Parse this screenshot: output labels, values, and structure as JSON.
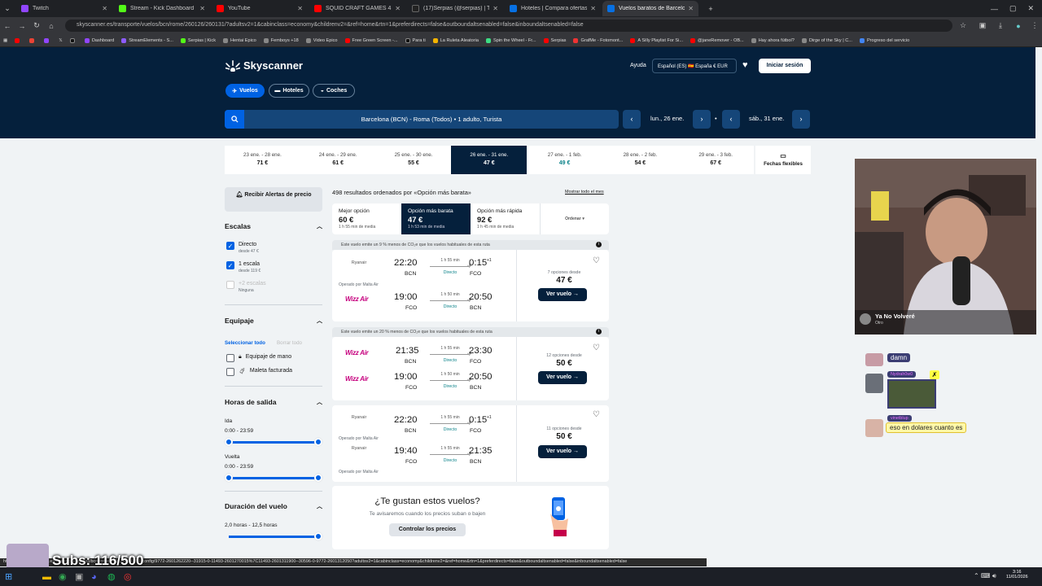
{
  "browser": {
    "tabs": [
      {
        "label": "Twitch",
        "color": "#9146ff"
      },
      {
        "label": "Stream - Kick Dashboard",
        "color": "#53fc18"
      },
      {
        "label": "YouTube",
        "color": "#ff0000"
      },
      {
        "label": "SQUID CRAFT GAMES 4: POV D",
        "color": "#ff0000"
      },
      {
        "label": "(17)Serpias (@serpias) | TikTok",
        "color": "#222222"
      },
      {
        "label": "Hoteles | Compara ofertas de h",
        "color": "#0770e3"
      },
      {
        "label": "Vuelos baratos de Barcelona a",
        "color": "#0770e3"
      }
    ],
    "url": "skyscanner.es/transporte/vuelos/bcn/rome/260126/260131/?adultsv2=1&cabinclass=economy&childrenv2=&ref=home&rtn=1&preferdirects=false&outboundaltsenabled=false&inboundaltsenabled=false",
    "bookmarks": [
      "Dashboard",
      "StreamElements - S...",
      "Serpias | Kick",
      "Hentai Epico",
      "Femboys +18",
      "Video Epico",
      "Free Green Screen -...",
      "Para ti",
      "La Ruleta Aleatoria",
      "Spin the Wheel - Fr...",
      "Serpias",
      "GrafMe - Fotomont...",
      "A Silly Playlist For Si...",
      "@janeRemover - OB...",
      "Hay ahora fútbol?",
      "Dirge of the Sky | C...",
      "Progreso del servicio"
    ],
    "status_url": "https://www.skyscanner.es/transporte/vuelos/bcn/rome/260126/260131/config/9772-2601262220--31915-0-11493-2601270015%7C11493-2601311900--30596-0-9772-2601312050?adultsv2=1&cabinclass=economy&childrenv2=&ref=home&rtn=1&preferdirects=false&outboundaltsenabled=false&inboundaltsenabled=false",
    "clock": {
      "time": "3:16",
      "date": "11/01/2026"
    }
  },
  "header": {
    "logo": "Skyscanner",
    "help": "Ayuda",
    "locale": "Español (ES)  🇪🇸 España  € EUR",
    "login": "Iniciar sesión",
    "modes": [
      "Vuelos",
      "Hoteles",
      "Coches"
    ]
  },
  "search": {
    "summary": "Barcelona (BCN) - Roma (Todos)  •  1 adulto, Turista",
    "depart": "lun., 26 ene.",
    "return": "sáb., 31 ene."
  },
  "dates": [
    {
      "range": "23 ene. - 28 ene.",
      "price": "71 €",
      "green": false
    },
    {
      "range": "24 ene. - 29 ene.",
      "price": "61 €",
      "green": false
    },
    {
      "range": "25 ene. - 30 ene.",
      "price": "55 €",
      "green": false
    },
    {
      "range": "26 ene. - 31 ene.",
      "price": "47 €",
      "green": false
    },
    {
      "range": "27 ene. - 1 feb.",
      "price": "49 €",
      "green": true
    },
    {
      "range": "28 ene. - 2 feb.",
      "price": "54 €",
      "green": false
    },
    {
      "range": "29 ene. - 3 feb.",
      "price": "67 €",
      "green": false
    }
  ],
  "flexible": "Fechas flexibles",
  "sidebar": {
    "alert": "Recibir Alertas de precio",
    "stops_title": "Escalas",
    "stops": [
      {
        "label": "Directo",
        "sub": "desde 47 €"
      },
      {
        "label": "1 escala",
        "sub": "desde 119 €"
      },
      {
        "label": "+2 escalas",
        "sub": "Ninguna"
      }
    ],
    "luggage_title": "Equipaje",
    "select_all": "Seleccionar todo",
    "clear_all": "Borrar todo",
    "luggage": [
      "Equipaje de mano",
      "Maleta facturada"
    ],
    "times_title": "Horas de salida",
    "outbound_label": "Ida",
    "outbound_range": "0:00 - 23:59",
    "inbound_label": "Vuelta",
    "inbound_range": "0:00 - 23:59",
    "duration_title": "Duración del vuelo",
    "duration_range": "2,0 horas - 12,5 horas"
  },
  "results": {
    "count": "498 resultados ordenados por «Opción más barata»",
    "show_all": "Mostrar todo el mes",
    "sort": [
      {
        "label": "Mejor opción",
        "price": "60 €",
        "sub": "1 h 55 min de media"
      },
      {
        "label": "Opción más barata",
        "price": "47 €",
        "sub": "1 h 53 min de media"
      },
      {
        "label": "Opción más rápida",
        "price": "92 €",
        "sub": "1 h 45 min de media"
      }
    ],
    "order": "Ordenar",
    "eco1": "Este vuelo emite un 9 % menos de CO₂e que los vuelos habituales de esta ruta",
    "eco2": "Este vuelo emite un 20 % menos de CO₂e que los vuelos habituales de esta ruta",
    "card1": {
      "out": {
        "airline": "Ryanair",
        "dep": "22:20",
        "from": "BCN",
        "dur": "1 h 55 min",
        "type": "Directo",
        "arr": "0:15",
        "plus": "+1",
        "to": "FCO"
      },
      "opby": "Operado por Malta Air",
      "ret": {
        "airline": "Wizz Air",
        "dep": "19:00",
        "from": "FCO",
        "dur": "1 h 50 min",
        "type": "Directo",
        "arr": "20:50",
        "to": "BCN"
      },
      "options": "7 opciones desde",
      "price": "47 €",
      "cta": "Ver vuelo →"
    },
    "card2": {
      "out": {
        "airline": "Wizz Air",
        "dep": "21:35",
        "from": "BCN",
        "dur": "1 h 55 min",
        "type": "Directo",
        "arr": "23:30",
        "to": "FCO"
      },
      "ret": {
        "airline": "Wizz Air",
        "dep": "19:00",
        "from": "FCO",
        "dur": "1 h 50 min",
        "type": "Directo",
        "arr": "20:50",
        "to": "BCN"
      },
      "options": "12 opciones desde",
      "price": "50 €",
      "cta": "Ver vuelo →"
    },
    "card3": {
      "out": {
        "airline": "Ryanair",
        "dep": "22:20",
        "from": "BCN",
        "dur": "1 h 55 min",
        "type": "Directo",
        "arr": "0:15",
        "plus": "+1",
        "to": "FCO"
      },
      "opby1": "Operado por Malta Air",
      "ret": {
        "airline": "Ryanair",
        "dep": "19:40",
        "from": "FCO",
        "dur": "1 h 55 min",
        "type": "Directo",
        "arr": "21:35",
        "to": "BCN"
      },
      "opby2": "Operado por Malta Air",
      "options": "11 opciones desde",
      "price": "50 €",
      "cta": "Ver vuelo →"
    },
    "like": {
      "title": "¿Te gustan estos vuelos?",
      "text": "Te avisaremos cuando los precios suban o bajen",
      "button": "Controlar los precios"
    }
  },
  "stream": {
    "cam_title": "Ya No Volveré",
    "cam_sub": "Otro",
    "chat": [
      {
        "user": "",
        "msg": "damn"
      },
      {
        "user": "Nydrah0w0",
        "msg": ""
      },
      {
        "user": "vinetblup",
        "msg": "eso en dolares cuanto es"
      }
    ],
    "subs": "Subs: 116/500"
  }
}
